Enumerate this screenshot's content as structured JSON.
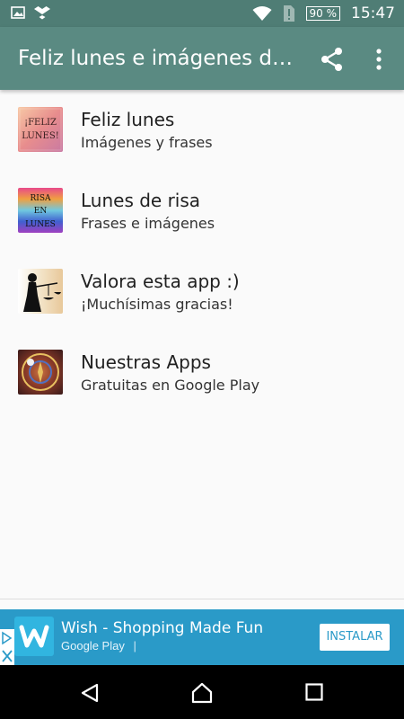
{
  "status_bar": {
    "battery": "90 %",
    "time": "15:47"
  },
  "app_bar": {
    "title": "Feliz lunes e imágenes de...",
    "accent": "#5a8a82"
  },
  "items": [
    {
      "title": "Feliz lunes",
      "subtitle": "Imágenes y frases",
      "thumb_text": "¡FELIZ LUNES!"
    },
    {
      "title": "Lunes de risa",
      "subtitle": "Frases e imágenes",
      "thumb_text": "RISA EN LUNES"
    },
    {
      "title": "Valora esta app :)",
      "subtitle": "¡Muchísimas gracias!"
    },
    {
      "title": "Nuestras Apps",
      "subtitle": "Gratuitas en Google Play"
    }
  ],
  "ad": {
    "title": "Wish - Shopping Made Fun",
    "store": "Google Play",
    "install": "INSTALAR"
  }
}
